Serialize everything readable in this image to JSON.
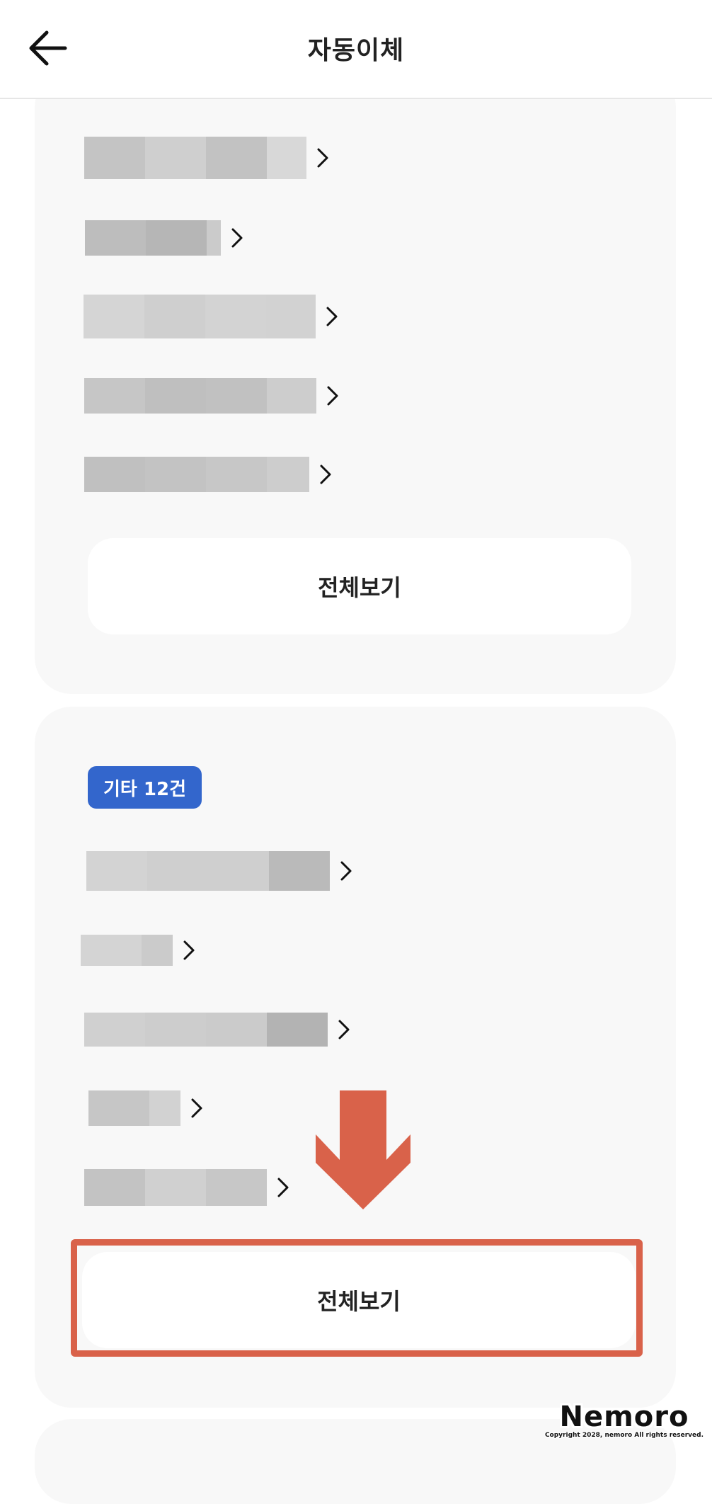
{
  "header": {
    "title": "자동이체",
    "back_icon": "arrow-left-icon"
  },
  "card_1": {
    "item_count": 5,
    "view_all_label": "전체보기"
  },
  "card_2": {
    "badge_label": "기타 12건",
    "item_count": 5,
    "view_all_label": "전체보기"
  },
  "annotation": {
    "arrow_icon": "arrow-down-icon",
    "color": "#d9624a"
  },
  "watermark": {
    "logo": "Nemoro",
    "copyright": "Copyright 2028, nemoro All rights reserved."
  },
  "colors": {
    "badge": "#3366cc",
    "card_bg": "#f8f8f8"
  }
}
